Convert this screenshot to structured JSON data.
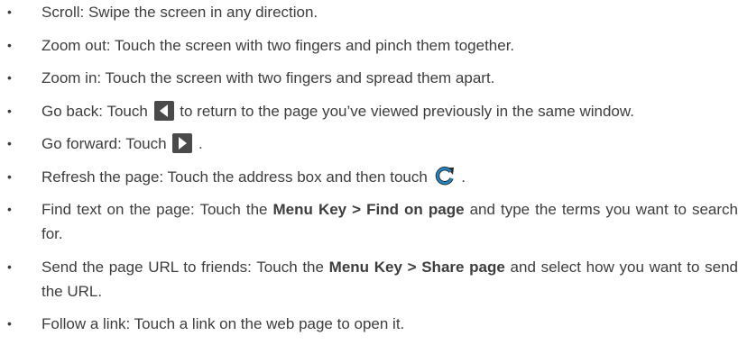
{
  "bullet_char": "•",
  "items": [
    {
      "text": "Scroll: Swipe the screen in any direction."
    },
    {
      "text": "Zoom out: Touch the screen with two fingers and pinch them together."
    },
    {
      "text": "Zoom in: Touch the screen with two fingers and spread them apart."
    },
    {
      "pre": "Go back: Touch ",
      "post": " to return to the page you’ve viewed previously in the same window.",
      "icon": "back-arrow-icon"
    },
    {
      "pre": "Go forward: Touch ",
      "post": " .",
      "icon": "forward-arrow-icon"
    },
    {
      "pre": "Refresh the page: Touch the address box and then touch ",
      "post": " .",
      "icon": "refresh-icon"
    },
    {
      "pre": "Find text on the page: Touch the ",
      "bold": "Menu Key > Find on page",
      "post": " and type the terms you want to search for."
    },
    {
      "pre": "Send the page URL to friends: Touch the ",
      "bold": "Menu Key > Share page",
      "post": " and select how you want to send the URL."
    },
    {
      "text": "Follow a link: Touch a link on the web page to open it."
    }
  ],
  "colors": {
    "text": "#3d3d3d",
    "icon_dark": "#4a4a4a",
    "icon_light": "#ffffff",
    "refresh_icon": "#1e88c8"
  }
}
